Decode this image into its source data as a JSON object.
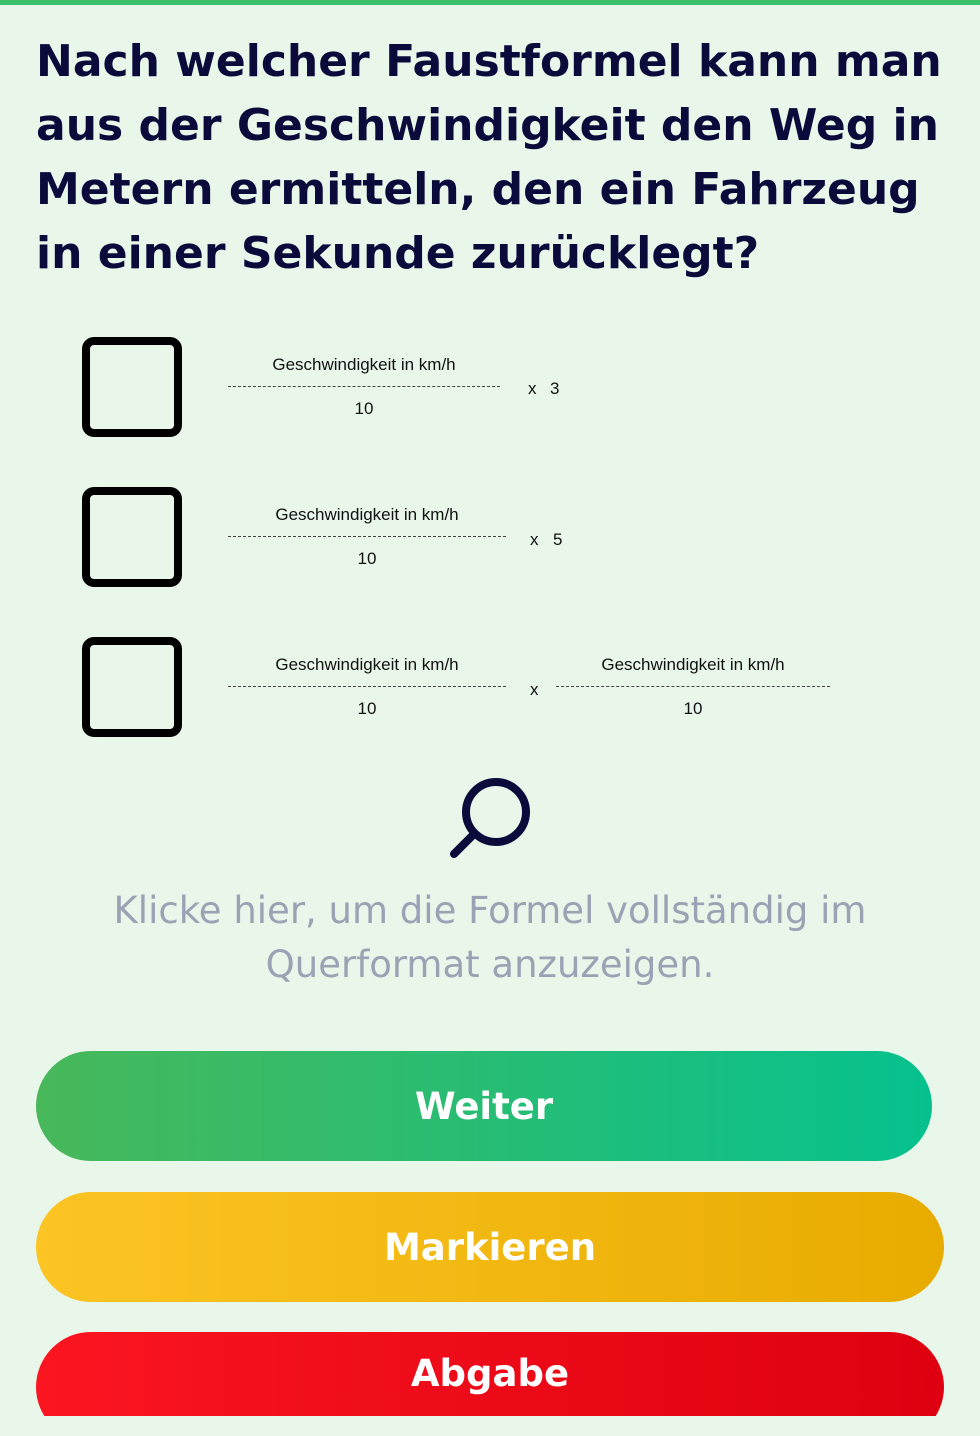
{
  "question": "Nach welcher Faustformel kann man aus der Geschwindigkeit den Weg in Metern ermitteln, den ein Fahrzeug in einer Sekunde zurücklegt?",
  "answers": [
    {
      "numerator": "Geschwindigkeit in km/h",
      "denominator": "10",
      "operator": "x",
      "factor": "3"
    },
    {
      "numerator": "Geschwindigkeit in km/h",
      "denominator": "10",
      "operator": "x",
      "factor": "5"
    },
    {
      "numerator": "Geschwindigkeit in km/h",
      "denominator": "10",
      "operator": "x",
      "numerator2": "Geschwindigkeit in km/h",
      "denominator2": "10"
    }
  ],
  "hint": "Klicke hier, um die Formel vollständig im Querformat anzuzeigen.",
  "icons": {
    "zoom": "search-icon"
  },
  "buttons": {
    "next": "Weiter",
    "mark": "Markieren",
    "submit": "Abgabe"
  },
  "colors": {
    "next": "#1dbb7a",
    "mark": "#f5bb12",
    "submit": "#f00e1a",
    "accent": "#3cbf6a"
  }
}
